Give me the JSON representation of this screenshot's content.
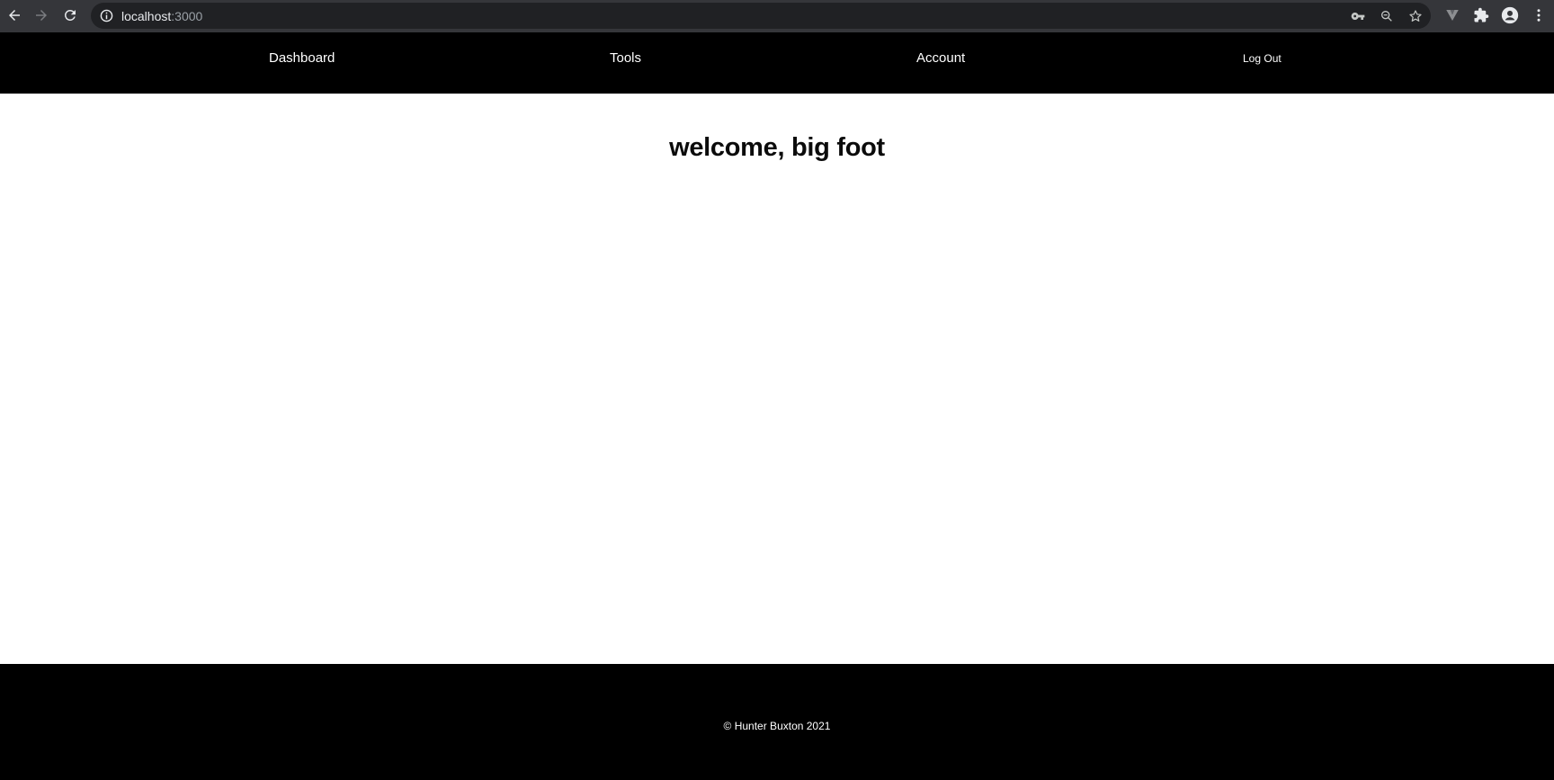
{
  "browser": {
    "url_host": "localhost",
    "url_port": ":3000",
    "icons": {
      "back": "back-arrow-icon",
      "forward": "forward-arrow-icon",
      "reload": "reload-icon",
      "site_info": "info-icon",
      "password": "key-icon",
      "zoom": "zoom-icon",
      "bookmark": "star-icon",
      "extension_vuetify": "v-extension-icon",
      "extensions": "puzzle-icon",
      "profile": "profile-icon",
      "menu": "kebab-menu-icon"
    },
    "colors": {
      "chrome_bg": "#35363a",
      "omnibox_bg": "#202124"
    }
  },
  "nav": {
    "items": [
      {
        "label": "Dashboard"
      },
      {
        "label": "Tools"
      },
      {
        "label": "Account"
      }
    ],
    "logout_label": "Log Out",
    "colors": {
      "bg": "#000000",
      "text": "#ffffff"
    }
  },
  "main": {
    "heading": "welcome, big foot"
  },
  "footer": {
    "copyright": "© Hunter Buxton 2021"
  }
}
